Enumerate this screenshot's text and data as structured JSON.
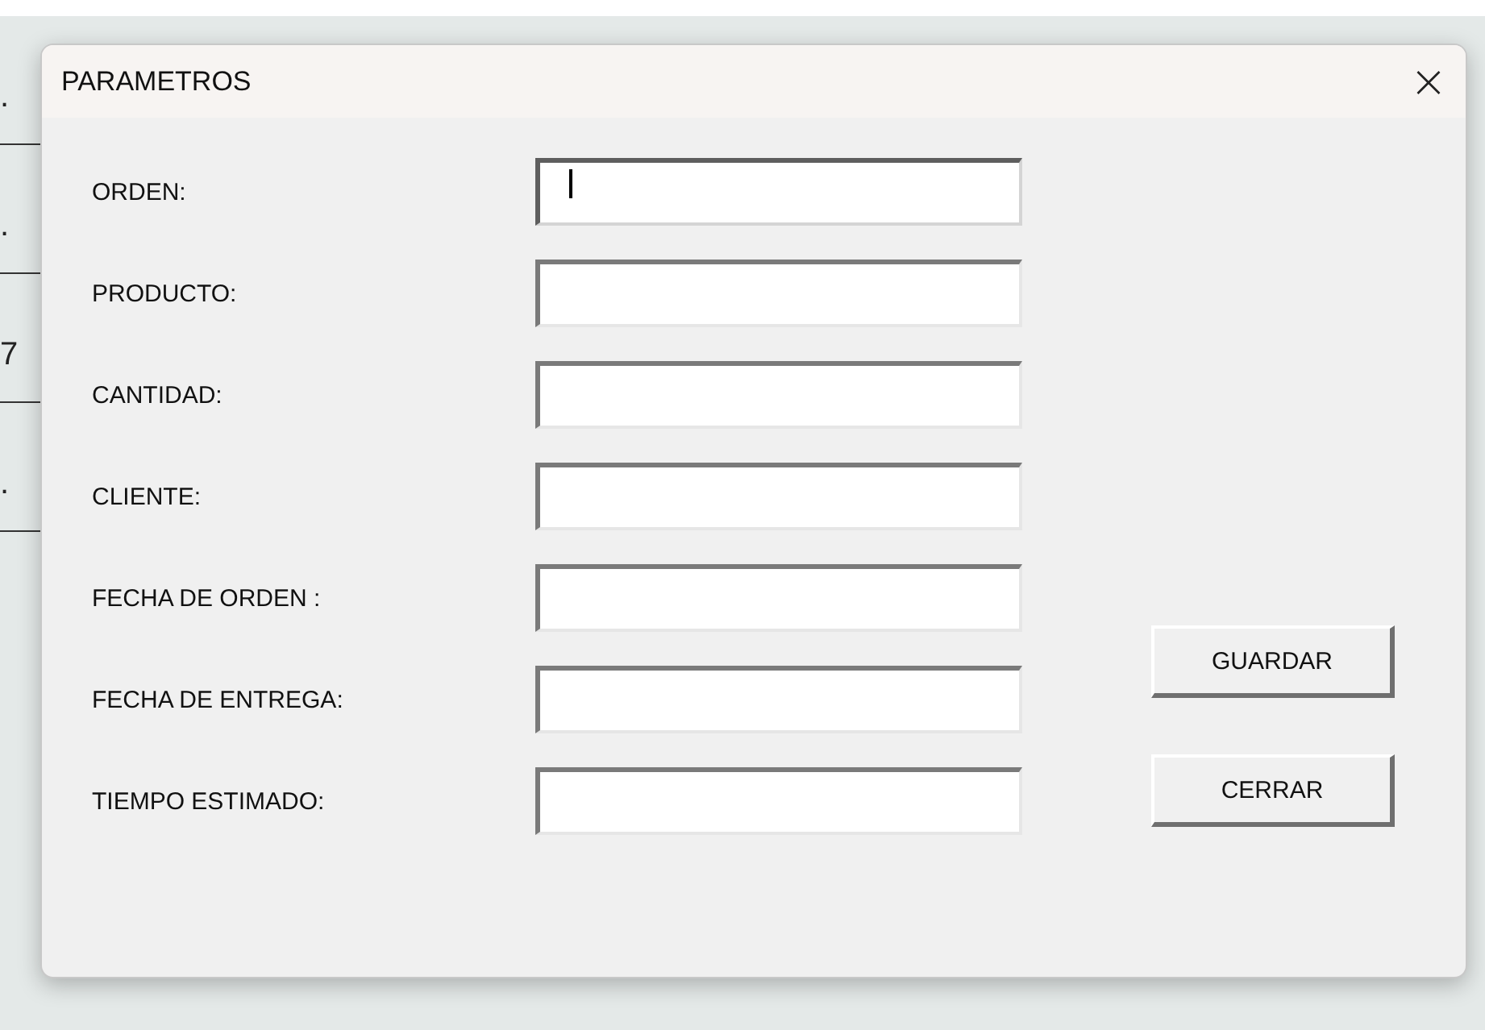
{
  "background_sheet": {
    "cells": [
      ".",
      ".",
      "7",
      "."
    ]
  },
  "window": {
    "title": "PARAMETROS",
    "close": "×"
  },
  "fields": [
    {
      "label": "ORDEN:",
      "focused": true
    },
    {
      "label": "PRODUCTO:",
      "focused": false
    },
    {
      "label": "CANTIDAD:",
      "focused": false
    },
    {
      "label": "CLIENTE:",
      "focused": false
    },
    {
      "label": "FECHA DE ORDEN :",
      "focused": false
    },
    {
      "label": "FECHA DE ENTREGA:",
      "focused": false
    },
    {
      "label": "TIEMPO ESTIMADO:",
      "focused": false
    }
  ],
  "buttons": [
    "GUARDAR",
    "CERRAR"
  ]
}
